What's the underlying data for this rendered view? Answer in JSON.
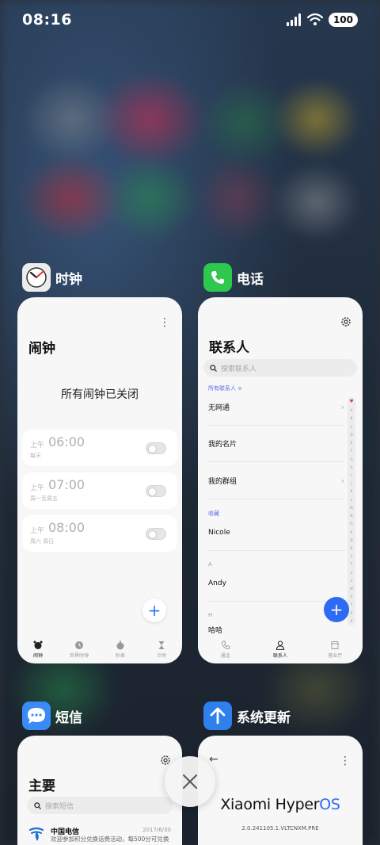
{
  "status_bar": {
    "time": "08:16",
    "battery": "100"
  },
  "clock_app": {
    "name": "时钟",
    "screen_title": "闹钟",
    "empty_message": "所有闹钟已关闭",
    "alarms": [
      {
        "ampm": "上午",
        "time": "06:00",
        "repeat": "每天",
        "enabled": false
      },
      {
        "ampm": "上午",
        "time": "07:00",
        "repeat": "周一至周五",
        "enabled": false
      },
      {
        "ampm": "上午",
        "time": "08:00",
        "repeat": "周六 周日",
        "enabled": false
      }
    ],
    "nav": [
      "闹钟",
      "世界时钟",
      "秒表",
      "计时"
    ]
  },
  "phone_app": {
    "name": "电话",
    "screen_title": "联系人",
    "search_placeholder": "搜索联系人",
    "group_label": "所有联系人 ≎",
    "rows": [
      "无网通",
      "我的名片",
      "我的群组"
    ],
    "favorites_label": "收藏",
    "favorite_contact": "Nicole",
    "section_a": "A",
    "contact_a": "Andy",
    "section_h": "H",
    "contact_h": "哈哈",
    "alpha_index": [
      "♥",
      "A",
      "B",
      "C",
      "D",
      "E",
      "F",
      "G",
      "H",
      "I",
      "J",
      "K",
      "L",
      "M",
      "N",
      "O",
      "P",
      "Q",
      "R",
      "S",
      "T",
      "U",
      "V",
      "W",
      "X",
      "Y",
      "Z",
      "#"
    ],
    "nav": [
      "通话",
      "联系人",
      "营业厅"
    ]
  },
  "sms_app": {
    "name": "短信",
    "screen_title": "主要",
    "search_placeholder": "搜索短信",
    "message": {
      "sender": "中国电信",
      "date": "2017/6/30",
      "preview": "欢迎参加积分兑换话费活动，每500分可兑换"
    }
  },
  "update_app": {
    "name": "系统更新",
    "brand_prefix": "Xiaomi Hyper",
    "brand_suffix": "OS",
    "version": "2.0.241105.1.VLTCNXM.PRE"
  },
  "colors": {
    "accent": "#2c6bf2",
    "clock_fab": "#2c7ef8",
    "phone_icon": "#2dc84d",
    "sms_icon": "#3a8bf5",
    "update_icon": "#2f80ed"
  }
}
